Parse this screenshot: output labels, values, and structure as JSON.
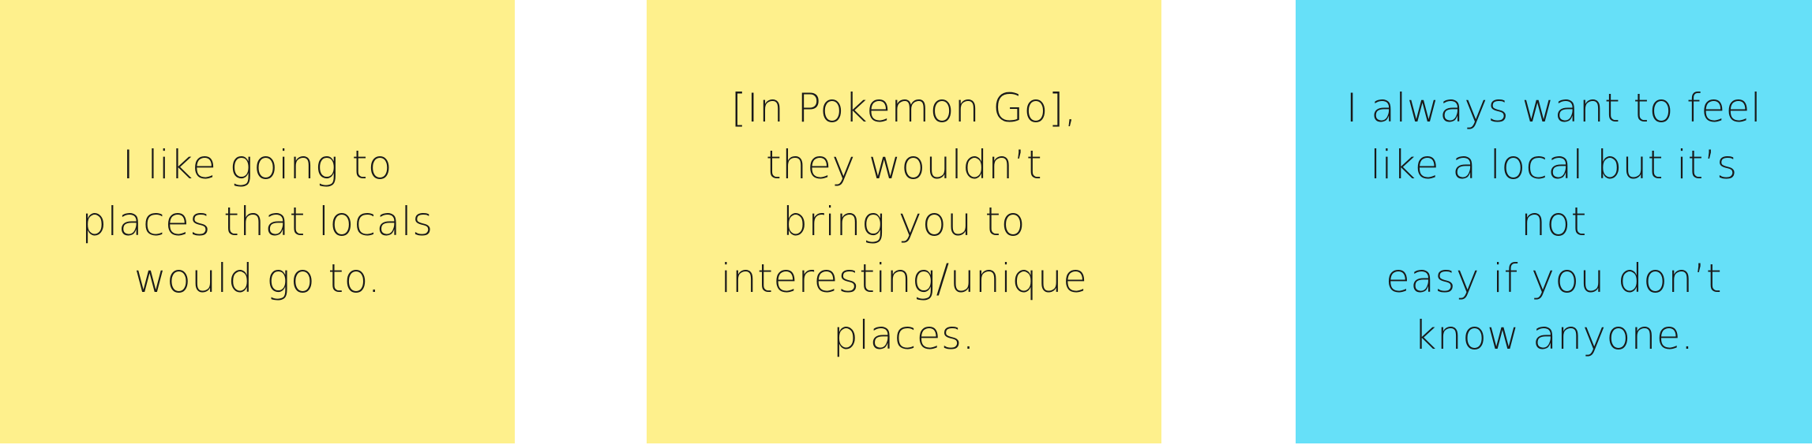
{
  "notes": [
    {
      "text": "I like going to\nplaces that locals\nwould go to.",
      "color": "#fef08c"
    },
    {
      "text": "[In Pokemon Go],\nthey wouldn’t\nbring you to\ninteresting/unique\nplaces.",
      "color": "#fef08c"
    },
    {
      "text": "I always want to feel\nlike a local but it’s not\neasy if you don’t\nknow anyone.",
      "color": "#66e0f8"
    }
  ]
}
